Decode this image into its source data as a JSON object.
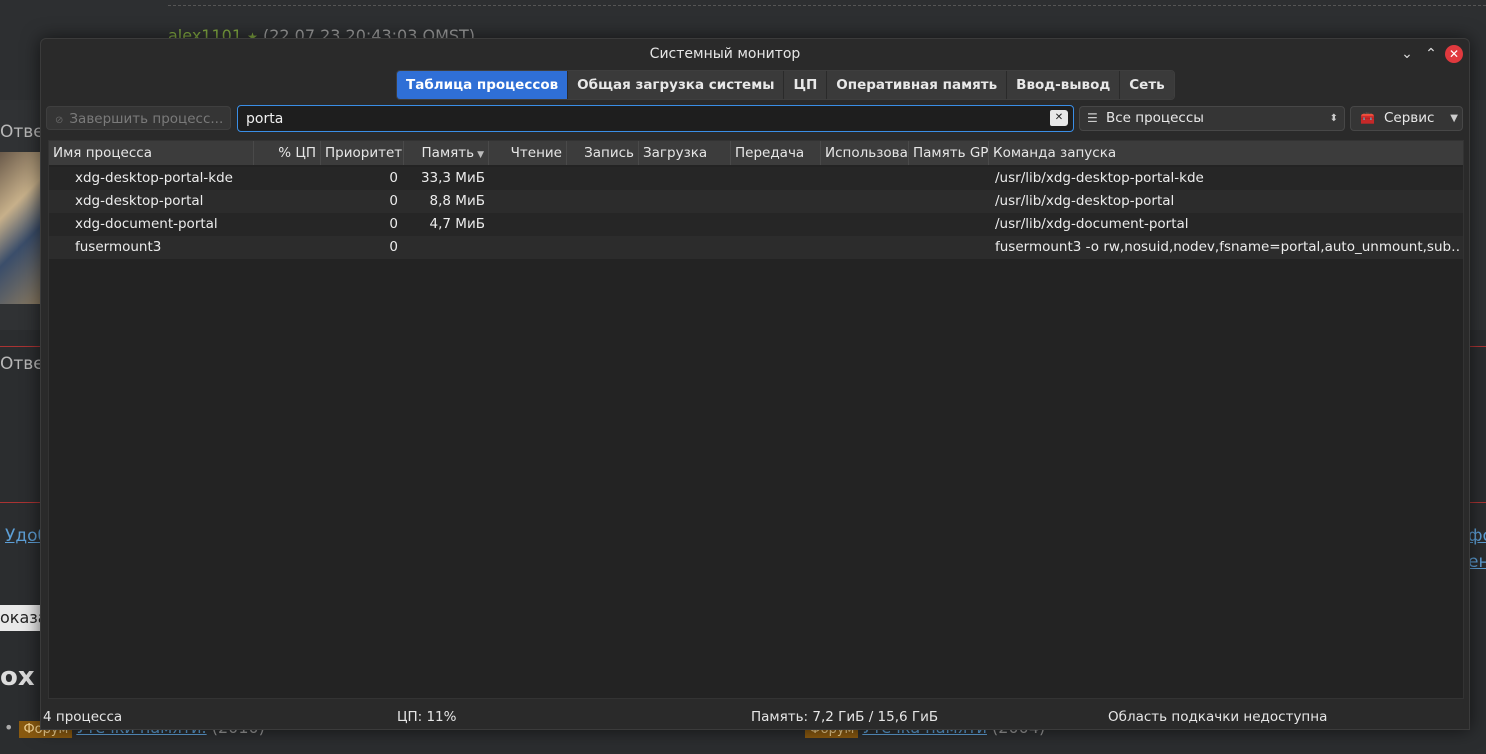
{
  "background": {
    "author": "alex1101",
    "author_time": "(22.07.23 20:43:03 OMST)",
    "reply_label_1": "Отве",
    "reply_label_2": "Отве",
    "link_left": "Удоб",
    "link_right_1": "фо",
    "link_right_2": "ена",
    "input_text": "оказа",
    "heading": "ох",
    "item1": {
      "tag": "Форум",
      "link": "Утечки памяти.",
      "year": "(2010)"
    },
    "item2": {
      "tag": "Форум",
      "link": "Утечка памяти",
      "year": "(2004)"
    }
  },
  "window": {
    "title": "Системный монитор",
    "controls": {
      "minimize": "⌄",
      "maximize": "⌃",
      "close": "✕"
    }
  },
  "tabs": [
    {
      "label": "Таблица процессов",
      "active": true
    },
    {
      "label": "Общая загрузка системы"
    },
    {
      "label": "ЦП"
    },
    {
      "label": "Оперативная память"
    },
    {
      "label": "Ввод-вывод"
    },
    {
      "label": "Сеть"
    }
  ],
  "toolbar": {
    "kill_label": "Завершить процесс...",
    "search_value": "porta",
    "filter_selected": "Все процессы",
    "service_label": "Сервис"
  },
  "columns": [
    "Имя процесса",
    "% ЦП",
    "Приоритет",
    "Память",
    "Чтение",
    "Запись",
    "Загрузка",
    "Передача",
    "Использова",
    "Память GPU",
    "Команда запуска"
  ],
  "rows": [
    {
      "name": "xdg-desktop-portal-kde",
      "cpu": "",
      "priority": "0",
      "memory": "33,3 МиБ",
      "command": "/usr/lib/xdg-desktop-portal-kde"
    },
    {
      "name": "xdg-desktop-portal",
      "cpu": "",
      "priority": "0",
      "memory": "8,8 МиБ",
      "command": "/usr/lib/xdg-desktop-portal"
    },
    {
      "name": "xdg-document-portal",
      "cpu": "",
      "priority": "0",
      "memory": "4,7 МиБ",
      "command": "/usr/lib/xdg-document-portal"
    },
    {
      "name": "fusermount3",
      "cpu": "",
      "priority": "0",
      "memory": "",
      "command": "fusermount3 -o rw,nosuid,nodev,fsname=portal,auto_unmount,sub…"
    }
  ],
  "status": {
    "processes": "4 процесса",
    "cpu": "ЦП: 11%",
    "memory": "Память: 7,2 ГиБ  /  15,6 ГиБ",
    "swap": "Область подкачки недоступна"
  }
}
